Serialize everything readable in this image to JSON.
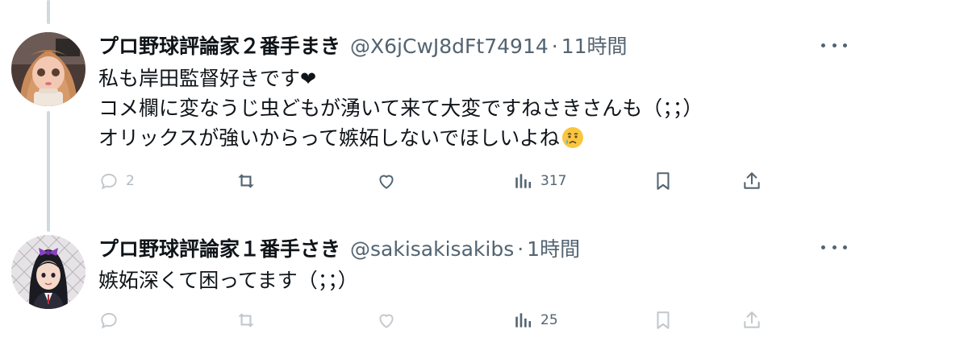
{
  "tweets": [
    {
      "display_name": "プロ野球評論家２番手まき",
      "handle": "@X6jCwJ8dFt74914",
      "separator": "·",
      "time": "11時間",
      "lines": [
        "私も岸田監督好きです",
        "コメ欄に変なうじ虫どもが湧いて来て大変ですねさきさんも（；；）",
        "オリックスが強いからって嫉妬しないでほしいよね"
      ],
      "emoji_heart": "❤",
      "emoji_crying": "😢",
      "actions": {
        "reply_count": "2",
        "retweet_count": "",
        "like_count": "",
        "views_count": "317"
      }
    },
    {
      "display_name": "プロ野球評論家１番手さき",
      "handle": "@sakisakisakibs",
      "separator": "·",
      "time": "1時間",
      "lines": [
        "嫉妬深くて困ってます（；；）"
      ],
      "actions": {
        "reply_count": "",
        "retweet_count": "",
        "like_count": "",
        "views_count": "25"
      }
    }
  ],
  "colors": {
    "text": "#0f1419",
    "secondary": "#536471",
    "thread_line": "#cfd9de",
    "heart": "#0f1419"
  },
  "icons": [
    "reply-icon",
    "retweet-icon",
    "like-icon",
    "views-icon",
    "bookmark-icon",
    "share-icon",
    "more-icon",
    "heart-emoji-icon",
    "crying-emoji-icon"
  ]
}
